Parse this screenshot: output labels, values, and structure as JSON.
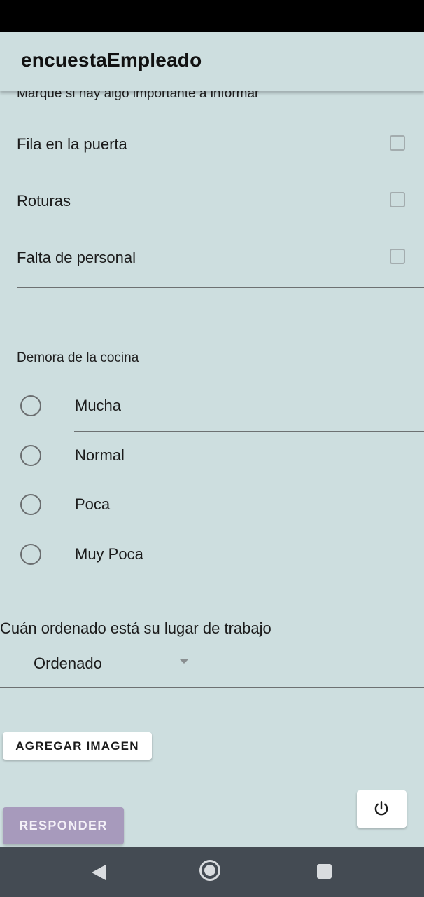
{
  "app": {
    "title": "encuestaEmpleado"
  },
  "checkbox_section": {
    "label": "Marque si hay algo importante a informar",
    "items": [
      {
        "label": "Fila en la puerta",
        "checked": false
      },
      {
        "label": "Roturas",
        "checked": false
      },
      {
        "label": "Falta de personal",
        "checked": false
      }
    ]
  },
  "radio_section": {
    "label": "Demora de la cocina",
    "options": [
      {
        "label": "Mucha",
        "selected": false
      },
      {
        "label": "Normal",
        "selected": false
      },
      {
        "label": "Poca",
        "selected": false
      },
      {
        "label": "Muy Poca",
        "selected": false
      }
    ]
  },
  "dropdown_section": {
    "question": "Cuán ordenado está su lugar de trabajo",
    "selected_value": "Ordenado"
  },
  "buttons": {
    "add_image": "AGREGAR IMAGEN",
    "respond": "RESPONDER",
    "power_icon": "power-icon"
  },
  "nav_bar": {
    "back_icon": "back-triangle-icon",
    "home_icon": "home-circle-icon",
    "recents_icon": "recents-square-icon"
  },
  "colors": {
    "background": "#cddedf",
    "respond_button": "#a79abc",
    "nav_bar": "#444b53"
  }
}
